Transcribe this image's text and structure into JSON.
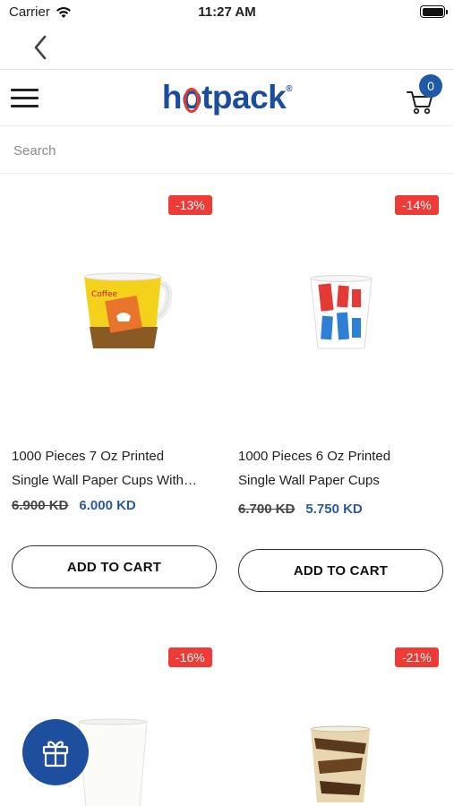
{
  "status_bar": {
    "carrier": "Carrier",
    "time": "11:27 AM",
    "icons": [
      "wifi-icon",
      "battery-icon"
    ]
  },
  "nav": {
    "back_icon": "chevron-left-icon"
  },
  "header": {
    "menu_icon": "hamburger-icon",
    "logo_text_h": "h",
    "logo_text_o": "o",
    "logo_text_rest": "tpack",
    "logo_mark": "®",
    "cart_icon": "cart-icon",
    "cart_count": "0"
  },
  "search": {
    "placeholder": "Search"
  },
  "products": [
    {
      "discount": "-13%",
      "title_line1": "1000 Pieces 7 Oz Printed",
      "title_line2": "Single Wall Paper Cups With…",
      "old_price": "6.900 KD",
      "new_price": "6.000 KD",
      "button": "ADD TO CART"
    },
    {
      "discount": "-14%",
      "title_line1": "1000 Pieces 6 Oz Printed",
      "title_line2": "Single Wall Paper Cups",
      "old_price": "6.700 KD",
      "new_price": "5.750 KD",
      "button": "ADD TO CART"
    },
    {
      "discount": "-16%"
    },
    {
      "discount": "-21%"
    }
  ],
  "fab": {
    "icon": "gift-icon"
  },
  "colors": {
    "brand_blue": "#1e5aa8",
    "discount_red": "#ee3b36",
    "price_blue": "#2a5a9a"
  }
}
